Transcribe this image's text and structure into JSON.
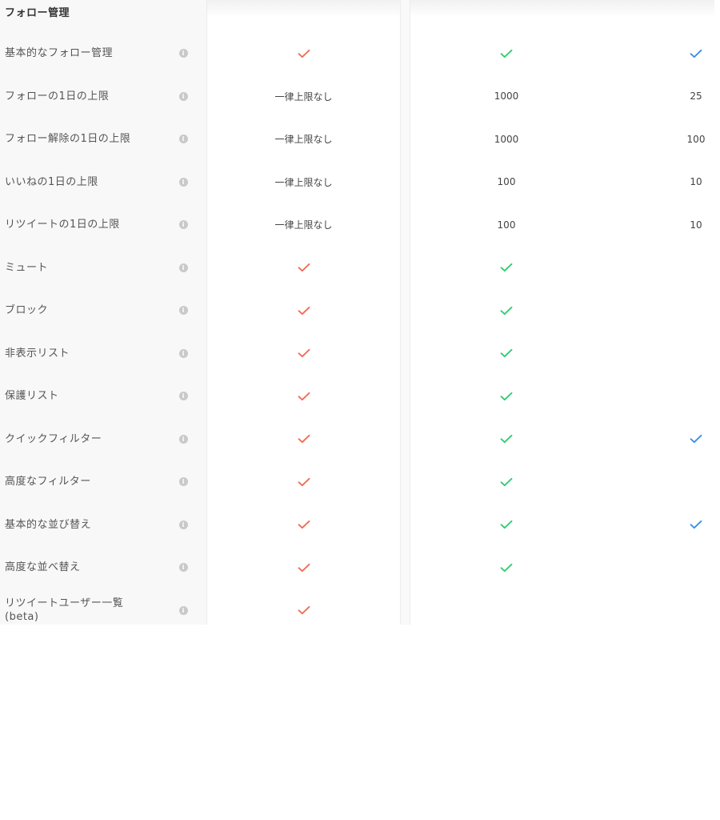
{
  "section": {
    "title": "フォロー管理"
  },
  "colors": {
    "plan1_check": "#f06a55",
    "plan2_check": "#2ecc71",
    "plan3_check": "#3a8ee6"
  },
  "icons": {
    "info": "info-icon",
    "check": "check-icon"
  },
  "info_glyph": "i",
  "rows": [
    {
      "label": "基本的なフォロー管理",
      "plan1": "check",
      "plan2": "check",
      "plan3": "check"
    },
    {
      "label": "フォローの1日の上限",
      "plan1": "一律上限なし",
      "plan2": "1000",
      "plan3": "25"
    },
    {
      "label": "フォロー解除の1日の上限",
      "plan1": "一律上限なし",
      "plan2": "1000",
      "plan3": "100"
    },
    {
      "label": "いいねの1日の上限",
      "plan1": "一律上限なし",
      "plan2": "100",
      "plan3": "10"
    },
    {
      "label": "リツイートの1日の上限",
      "plan1": "一律上限なし",
      "plan2": "100",
      "plan3": "10"
    },
    {
      "label": "ミュート",
      "plan1": "check",
      "plan2": "check",
      "plan3": ""
    },
    {
      "label": "ブロック",
      "plan1": "check",
      "plan2": "check",
      "plan3": ""
    },
    {
      "label": "非表示リスト",
      "plan1": "check",
      "plan2": "check",
      "plan3": ""
    },
    {
      "label": "保護リスト",
      "plan1": "check",
      "plan2": "check",
      "plan3": ""
    },
    {
      "label": "クイックフィルター",
      "plan1": "check",
      "plan2": "check",
      "plan3": "check"
    },
    {
      "label": "高度なフィルター",
      "plan1": "check",
      "plan2": "check",
      "plan3": ""
    },
    {
      "label": "基本的な並び替え",
      "plan1": "check",
      "plan2": "check",
      "plan3": "check"
    },
    {
      "label": "高度な並べ替え",
      "plan1": "check",
      "plan2": "check",
      "plan3": ""
    },
    {
      "label": "リツイートユーザー一覧\n(beta)",
      "plan1": "check",
      "plan2": "",
      "plan3": ""
    }
  ]
}
